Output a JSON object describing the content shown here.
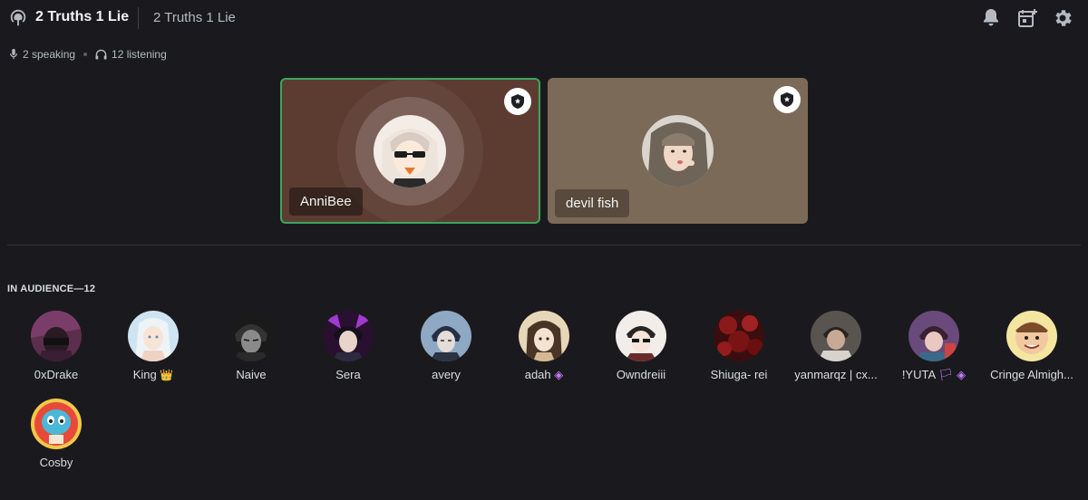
{
  "header": {
    "title": "2 Truths 1 Lie",
    "topic": "2 Truths 1 Lie",
    "icons": [
      "stage-channel-icon",
      "bell-icon",
      "event-add-icon",
      "gear-icon"
    ]
  },
  "stats": {
    "speaking": "2 speaking",
    "listening": "12 listening"
  },
  "speakers": [
    {
      "name": "AnniBee",
      "active": true,
      "badge": "moderator-badge-icon"
    },
    {
      "name": "devil fish",
      "active": false,
      "badge": "moderator-badge-icon"
    }
  ],
  "audience": {
    "heading": "IN AUDIENCE—12",
    "members": [
      {
        "name": "0xDrake",
        "extra": ""
      },
      {
        "name": "King",
        "extra": "👑"
      },
      {
        "name": "Naive",
        "extra": ""
      },
      {
        "name": "Sera",
        "extra": ""
      },
      {
        "name": "avery",
        "extra": ""
      },
      {
        "name": "adah",
        "extra": "◈"
      },
      {
        "name": "Owndreiii",
        "extra": ""
      },
      {
        "name": "Shiuga- rei",
        "extra": ""
      },
      {
        "name": "yanmarqz | cx...",
        "extra": ""
      },
      {
        "name": "!YUTA",
        "extra": "🏳 ◈"
      },
      {
        "name": "Cringe Almigh...",
        "extra": ""
      },
      {
        "name": "Cosby",
        "extra": ""
      }
    ]
  },
  "colors": {
    "background": "#1a1a1e",
    "speaking_ring": "#3ba55d",
    "tile_1": "#5c3c31",
    "tile_2": "#7b6a58"
  }
}
